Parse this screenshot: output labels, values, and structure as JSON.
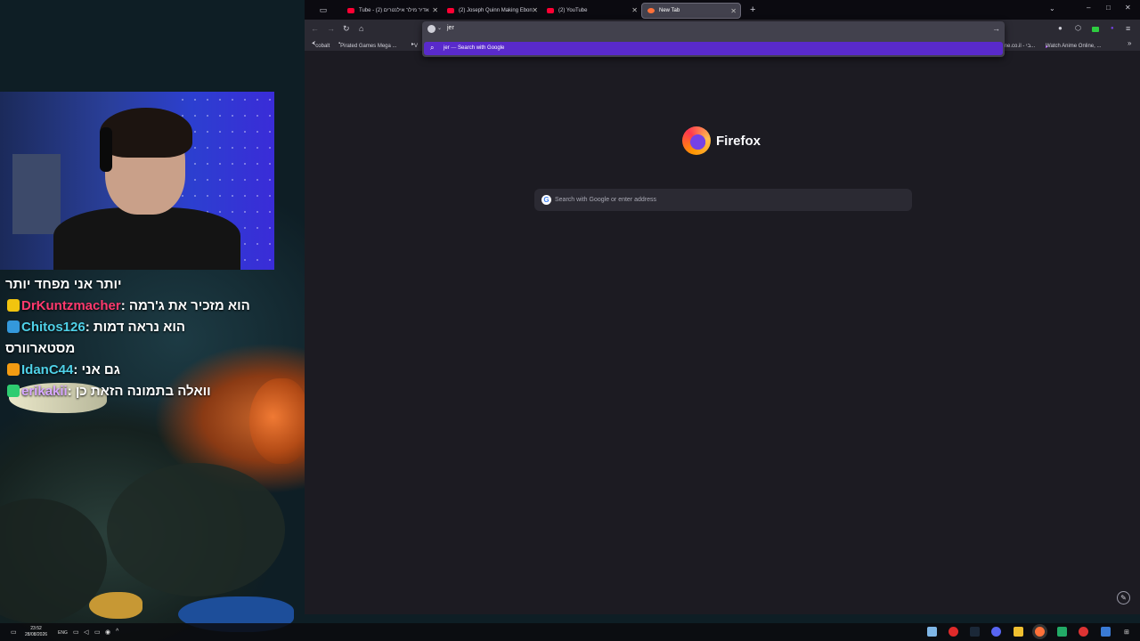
{
  "browser": {
    "tabs": [
      {
        "label": "Tube - אדיר מילר אילנטרים (2)",
        "active": false
      },
      {
        "label": "(2) Joseph Quinn Making Ebon",
        "active": false
      },
      {
        "label": "(2) YouTube",
        "active": false
      },
      {
        "label": "New Tab",
        "active": true
      }
    ],
    "new_tab_glyph": "+",
    "bookmarks": [
      "cobalt",
      "Pirated Games Mega ...",
      "V",
      "me.co.il - בי...",
      "Watch Anime Online, ..."
    ],
    "urlbar": {
      "typed": "jer",
      "suggestion_query": "jer",
      "suggestion_separator": "—",
      "suggestion_action": "Search with Google"
    },
    "newtab": {
      "logo_text": "Firefox",
      "search_placeholder": "Search with Google or enter address"
    }
  },
  "chat": [
    {
      "user": "",
      "message": "יותר אני מפחד יותר",
      "user_color": "#ffffff"
    },
    {
      "user": "DrKuntzmacher",
      "message": "הוא מזכיר את ג'רמה",
      "user_color": "#ff3a6e"
    },
    {
      "user": "Chitos126",
      "message": "הוא נראה דמות",
      "user_color": "#4fd1e8"
    },
    {
      "user": "",
      "message": "מסטארוורס",
      "user_color": "#ffffff"
    },
    {
      "user": "IdanC44",
      "message": "גם אני",
      "user_color": "#4fd1e8"
    },
    {
      "user": "erikakii",
      "message": "וואלה בתמונה הזאת כן",
      "user_color": "#d6a6ff"
    }
  ],
  "taskbar": {
    "lang": "ENG",
    "time": "23:52",
    "date": "28/08/2026"
  },
  "colors": {
    "accent_suggestion": "#592acb",
    "browser_bg": "#1c1b22"
  }
}
